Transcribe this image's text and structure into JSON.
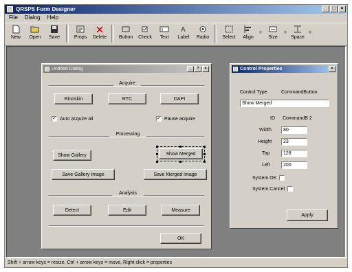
{
  "app": {
    "title": "QRSPS Form Designer",
    "menu": [
      "File",
      "Dialog",
      "Help"
    ]
  },
  "toolbar": [
    {
      "label": "New",
      "icon": "new-file-icon"
    },
    {
      "label": "Open",
      "icon": "open-folder-icon"
    },
    {
      "label": "Save",
      "icon": "save-disk-icon"
    },
    {
      "label": "Props",
      "icon": "properties-icon"
    },
    {
      "label": "Delete",
      "icon": "delete-icon"
    },
    {
      "label": "Button",
      "icon": "button-tool-icon"
    },
    {
      "label": "Check",
      "icon": "checkbox-tool-icon"
    },
    {
      "label": "Text",
      "icon": "text-tool-icon"
    },
    {
      "label": "Label",
      "icon": "label-tool-icon"
    },
    {
      "label": "Radio",
      "icon": "radio-tool-icon"
    },
    {
      "label": "Select",
      "icon": "select-tool-icon"
    },
    {
      "label": "Align",
      "icon": "align-tool-icon"
    },
    {
      "label": "Size",
      "icon": "size-tool-icon"
    },
    {
      "label": "Space",
      "icon": "space-tool-icon"
    }
  ],
  "form_dialog": {
    "title": "Untitled Dialog",
    "sections": {
      "acquire": "Acquire",
      "processing": "Processing",
      "analysis": "Analysis"
    },
    "buttons": {
      "rinoskin": "Rinoskin",
      "rtc": "RTC",
      "dapi": "DAPI",
      "show_gallery": "Show Gallery",
      "show_merged": "Show Merged",
      "save_gallery": "Save Gallery Image",
      "save_merged": "Save Merged Image",
      "detect": "Detect",
      "edit": "Edit",
      "measure": "Measure",
      "ok": "OK"
    },
    "checkboxes": {
      "auto_acquire": "Auto acquire all",
      "pause_acquire": "Pause acquire"
    }
  },
  "properties": {
    "title": "Control Properties",
    "control_type_label": "Control Type",
    "control_type_value": "CommandButton",
    "caption_value": "Show Merged",
    "fields": [
      {
        "label": "ID",
        "value": "CommandB 2"
      },
      {
        "label": "Width",
        "value": "80"
      },
      {
        "label": "Height",
        "value": "23"
      },
      {
        "label": "Top",
        "value": "128"
      },
      {
        "label": "Left",
        "value": "200"
      }
    ],
    "system_ok_label": "System OK",
    "system_cancel_label": "System Cancel",
    "apply_label": "Apply"
  },
  "status": {
    "text": "Shift + arrow keys = resize, Ctrl + arrow keys = move, Right click = properties"
  }
}
